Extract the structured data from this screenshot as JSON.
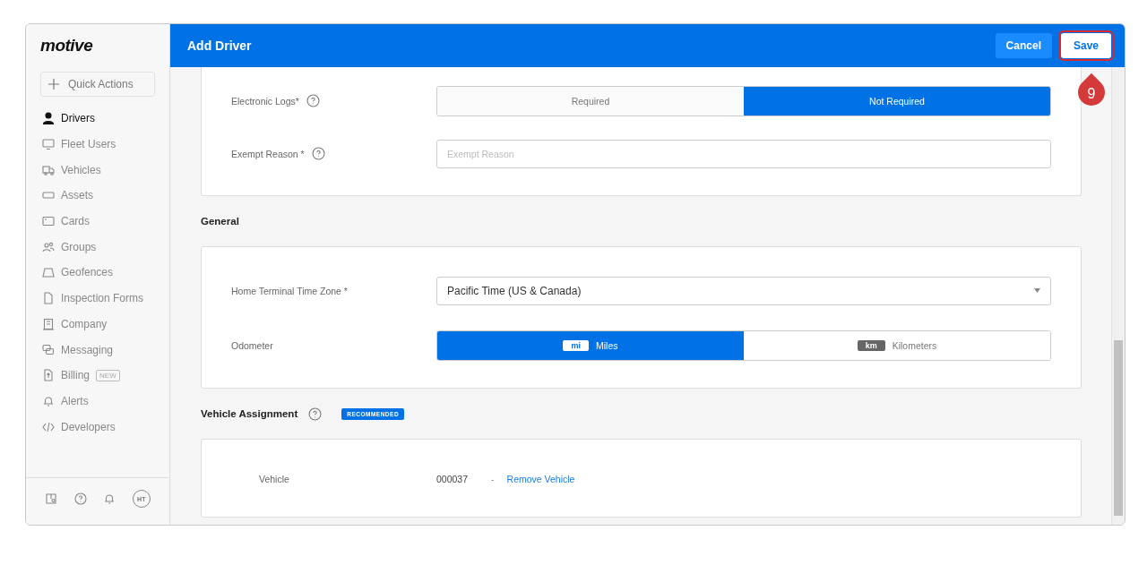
{
  "sidebar": {
    "logo": "motive",
    "quick_actions": "Quick Actions",
    "items": [
      {
        "label": "Drivers",
        "selected": true
      },
      {
        "label": "Fleet Users",
        "selected": false
      },
      {
        "label": "Vehicles",
        "selected": false
      },
      {
        "label": "Assets",
        "selected": false
      },
      {
        "label": "Cards",
        "selected": false
      },
      {
        "label": "Groups",
        "selected": false
      },
      {
        "label": "Geofences",
        "selected": false
      },
      {
        "label": "Inspection Forms",
        "selected": false
      },
      {
        "label": "Company",
        "selected": false
      },
      {
        "label": "Messaging",
        "selected": false
      },
      {
        "label": "Billing",
        "selected": false,
        "badge": "NEW"
      },
      {
        "label": "Alerts",
        "selected": false
      },
      {
        "label": "Developers",
        "selected": false
      }
    ],
    "avatar": "HT"
  },
  "header": {
    "title": "Add Driver",
    "buttons": [
      {
        "label": "Cancel",
        "kind": "secondary",
        "highlighted": false
      },
      {
        "label": "Save",
        "kind": "primary",
        "highlighted": true
      }
    ],
    "step_marker": "9"
  },
  "sections": [
    {
      "fields": [
        {
          "kind": "segmented",
          "label": "Electronic Logs*",
          "help": true,
          "options": [
            {
              "label": "Required",
              "selected": false
            },
            {
              "label": "Not Required",
              "selected": true
            }
          ]
        },
        {
          "kind": "input",
          "label": "Exempt Reason *",
          "help": true,
          "placeholder": "Exempt Reason"
        }
      ]
    },
    {
      "title": "General",
      "fields": [
        {
          "kind": "select",
          "label": "Home Terminal Time Zone *",
          "help": false,
          "value": "Pacific Time (US & Canada)"
        },
        {
          "kind": "segmented",
          "label": "Odometer",
          "help": false,
          "options": [
            {
              "tag": "mi",
              "label": "Miles",
              "selected": true
            },
            {
              "tag": "km",
              "label": "Kilometers",
              "selected": false
            }
          ]
        }
      ]
    },
    {
      "title": "Vehicle Assignment",
      "help": true,
      "badge": "RECOMMENDED",
      "fields": [
        {
          "kind": "vehicle",
          "label": "Vehicle",
          "help": false,
          "value": "000037",
          "separator": "-",
          "link": "Remove Vehicle"
        }
      ]
    }
  ]
}
